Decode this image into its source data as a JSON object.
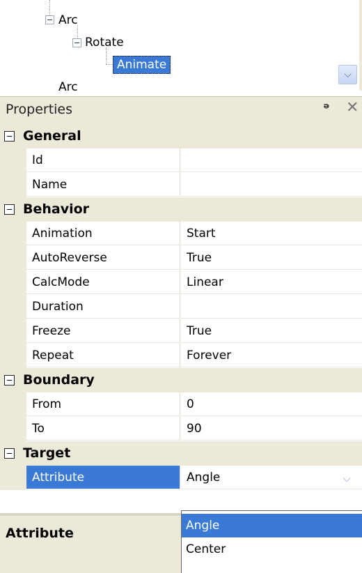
{
  "tree": {
    "nodes": [
      {
        "label": "Arc"
      },
      {
        "label": "Rotate"
      },
      {
        "label": "Animate"
      },
      {
        "label": "Arc"
      }
    ]
  },
  "properties": {
    "title": "Properties",
    "categories": [
      {
        "label": "General",
        "rows": [
          {
            "name": "Id",
            "value": ""
          },
          {
            "name": "Name",
            "value": ""
          }
        ]
      },
      {
        "label": "Behavior",
        "rows": [
          {
            "name": "Animation",
            "value": "Start"
          },
          {
            "name": "AutoReverse",
            "value": "True"
          },
          {
            "name": "CalcMode",
            "value": "Linear"
          },
          {
            "name": "Duration",
            "value": ""
          },
          {
            "name": "Freeze",
            "value": "True"
          },
          {
            "name": "Repeat",
            "value": "Forever"
          }
        ]
      },
      {
        "label": "Boundary",
        "rows": [
          {
            "name": "From",
            "value": "0"
          },
          {
            "name": "To",
            "value": "90"
          }
        ]
      },
      {
        "label": "Target",
        "rows": [
          {
            "name": "Attribute",
            "value": "Angle"
          }
        ]
      }
    ]
  },
  "description": {
    "label": "Attribute"
  },
  "dropdown": {
    "options": [
      "Angle",
      "Center"
    ],
    "selected": "Angle"
  },
  "colors": {
    "selection": "#3a79d4",
    "panel": "#ece9d8"
  }
}
